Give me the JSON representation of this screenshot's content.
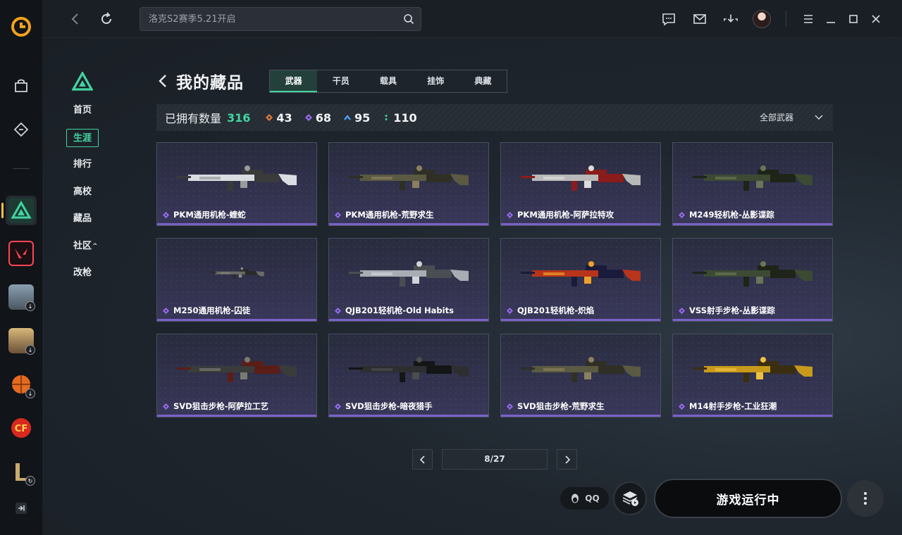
{
  "search": {
    "placeholder": "洛克S2赛季5.21开启"
  },
  "side_nav": [
    {
      "label": "首页",
      "active": false
    },
    {
      "label": "生涯",
      "active": true
    },
    {
      "label": "排行",
      "active": false
    },
    {
      "label": "高校",
      "active": false
    },
    {
      "label": "藏品",
      "active": false
    },
    {
      "label": "社区",
      "active": false,
      "has_caret": true
    },
    {
      "label": "改枪",
      "active": false
    }
  ],
  "page": {
    "title": "我的藏品"
  },
  "tabs": [
    {
      "label": "武器",
      "active": true
    },
    {
      "label": "干员",
      "active": false
    },
    {
      "label": "载具",
      "active": false
    },
    {
      "label": "挂饰",
      "active": false
    },
    {
      "label": "典藏",
      "active": false
    }
  ],
  "stats": {
    "owned_label": "已拥有数量",
    "owned_count": "316",
    "rarities": [
      {
        "icon": "orange-diamond-icon",
        "color": "#e07a3a",
        "count": "43"
      },
      {
        "icon": "purple-diamond-icon",
        "color": "#9a6cf0",
        "count": "68"
      },
      {
        "icon": "blue-chevron-icon",
        "color": "#4aa3f0",
        "count": "95"
      },
      {
        "icon": "green-dots-icon",
        "color": "#43d4a0",
        "count": "110"
      }
    ],
    "filter_label": "全部武器"
  },
  "cards": [
    {
      "name": "PKM通用机枪-蝰蛇",
      "palette": "white"
    },
    {
      "name": "PKM通用机枪-荒野求生",
      "palette": "camo"
    },
    {
      "name": "PKM通用机枪-阿萨拉特攻",
      "palette": "red"
    },
    {
      "name": "M249轻机枪-丛影谍踪",
      "palette": "green"
    },
    {
      "name": "M250通用机枪-囚徒",
      "palette": "small"
    },
    {
      "name": "QJB201轻机枪-Old Habits",
      "palette": "silver"
    },
    {
      "name": "QJB201轻机枪-炽焰",
      "palette": "fire"
    },
    {
      "name": "VSS射手步枪-丛影谍踪",
      "palette": "green"
    },
    {
      "name": "SVD狙击步枪-阿萨拉工艺",
      "palette": "wood"
    },
    {
      "name": "SVD狙击步枪-暗夜猎手",
      "palette": "dark"
    },
    {
      "name": "SVD狙击步枪-荒野求生",
      "palette": "camo"
    },
    {
      "name": "M14射手步枪-工业狂潮",
      "palette": "gold"
    }
  ],
  "pager": {
    "current": "8/27"
  },
  "footer": {
    "qq_label": "QQ",
    "play_label": "游戏运行中"
  },
  "colors": {
    "accent": "#43d4a0",
    "rarity_purple": "#7a62c8"
  }
}
